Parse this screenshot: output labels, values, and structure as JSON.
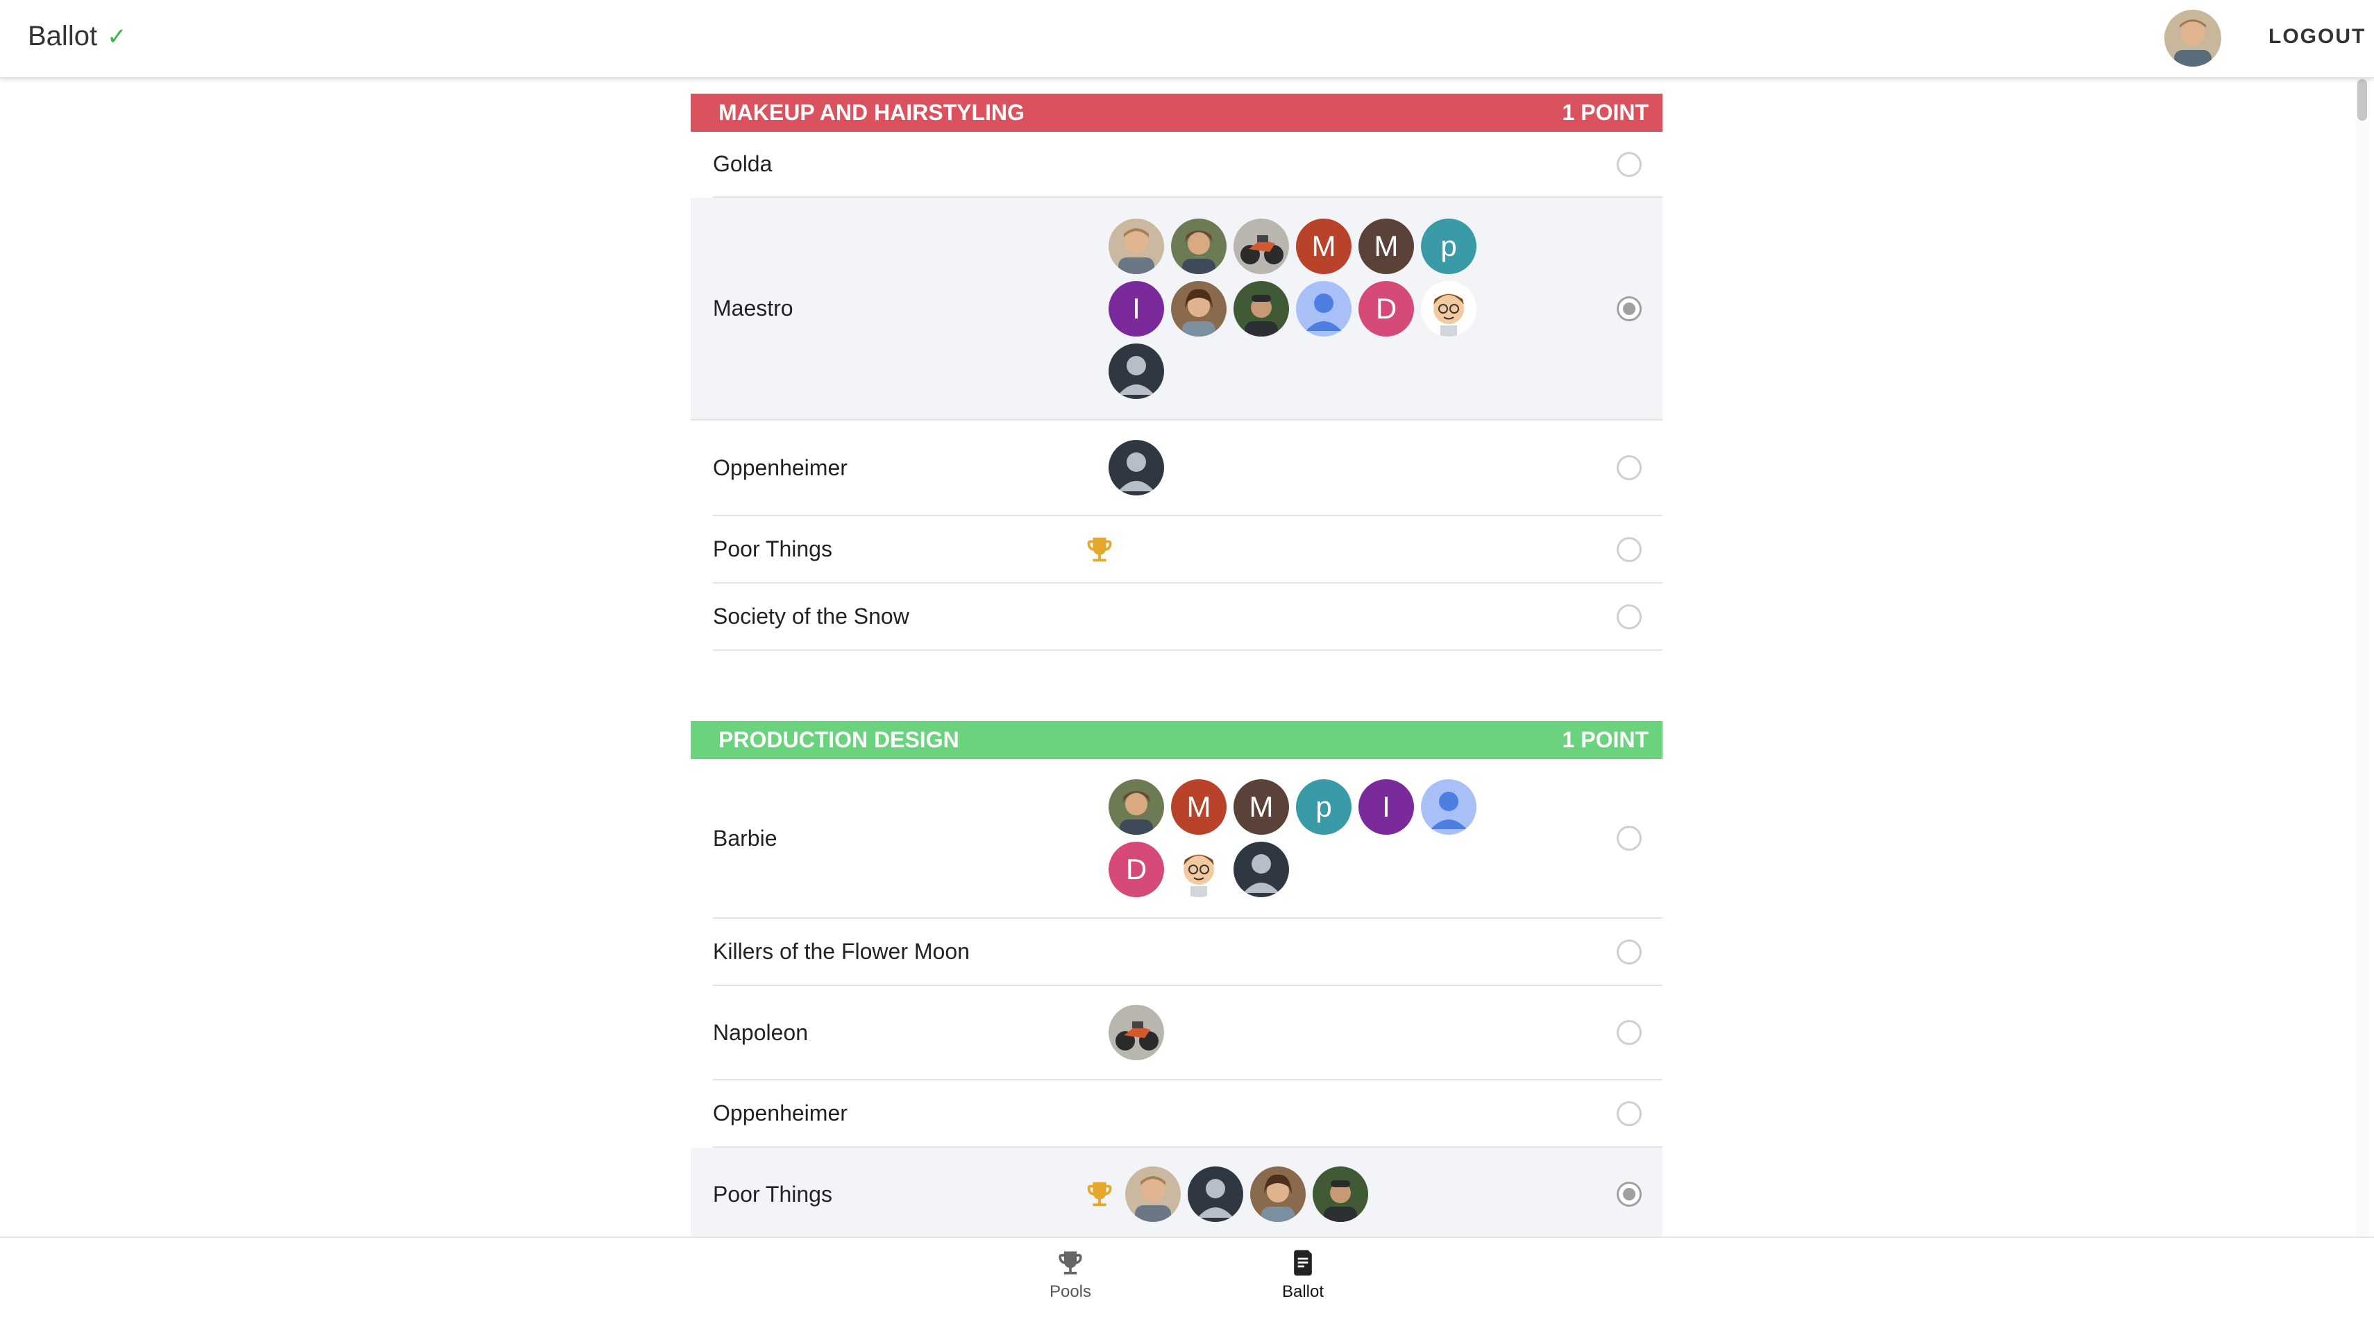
{
  "app": {
    "title": "Ballot",
    "check_icon": "check-icon",
    "logout_label": "LOGOUT"
  },
  "colors": {
    "makeup": "#d9525e",
    "production": "#6bd27d",
    "trophy": "#e5a82a",
    "check": "#3cb44b"
  },
  "sections": [
    {
      "name": "MAKEUP AND HAIRSTYLING",
      "points": "1 POINT",
      "color": "#d9525e",
      "nominees": [
        {
          "title": "Golda",
          "selected": false,
          "winner": false,
          "avatars": []
        },
        {
          "title": "Maestro",
          "selected": true,
          "winner": false,
          "avatars": [
            "photo-1",
            "photo-2",
            "photo-motorcycle",
            "M",
            "M2",
            "p",
            "I",
            "photo-3",
            "photo-4",
            "default-blue",
            "D",
            "emoji-face",
            "default-dark"
          ]
        },
        {
          "title": "Oppenheimer",
          "selected": false,
          "winner": false,
          "avatars": [
            "default-dark"
          ]
        },
        {
          "title": "Poor Things",
          "selected": false,
          "winner": true,
          "avatars": []
        },
        {
          "title": "Society of the Snow",
          "selected": false,
          "winner": false,
          "avatars": []
        }
      ]
    },
    {
      "name": "PRODUCTION DESIGN",
      "points": "1 POINT",
      "color": "#6bd27d",
      "nominees": [
        {
          "title": "Barbie",
          "selected": false,
          "winner": false,
          "avatars": [
            "photo-2",
            "M",
            "M2",
            "p",
            "I",
            "default-blue",
            "D",
            "emoji-face",
            "default-dark"
          ]
        },
        {
          "title": "Killers of the Flower Moon",
          "selected": false,
          "winner": false,
          "avatars": []
        },
        {
          "title": "Napoleon",
          "selected": false,
          "winner": false,
          "avatars": [
            "photo-motorcycle"
          ]
        },
        {
          "title": "Oppenheimer",
          "selected": false,
          "winner": false,
          "avatars": []
        },
        {
          "title": "Poor Things",
          "selected": true,
          "winner": true,
          "avatars": [
            "photo-1",
            "default-dark",
            "photo-3",
            "photo-4"
          ]
        }
      ]
    }
  ],
  "avatar_letters": {
    "M": "M",
    "M2": "M",
    "p": "p",
    "I": "I",
    "D": "D"
  },
  "bottom_nav": {
    "pools_label": "Pools",
    "ballot_label": "Ballot"
  }
}
